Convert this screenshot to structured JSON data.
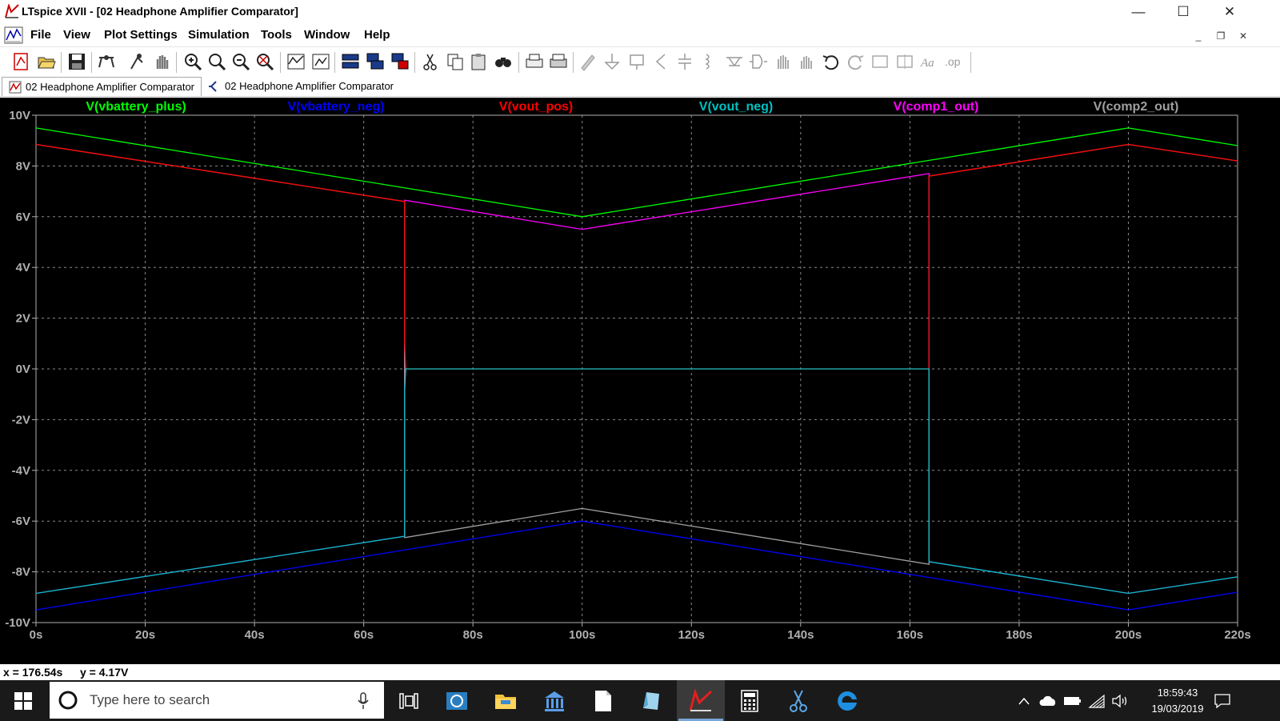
{
  "window": {
    "title": "LTspice XVII - [02 Headphone Amplifier Comparator]",
    "controls": {
      "minimize": "—",
      "maximize": "☐",
      "close": "✕"
    }
  },
  "menu": {
    "items": [
      "File",
      "View",
      "Plot Settings",
      "Simulation",
      "Tools",
      "Window",
      "Help"
    ]
  },
  "tabs": [
    {
      "label": "02 Headphone Amplifier Comparator",
      "icon": "waveform-icon",
      "active": true
    },
    {
      "label": "02 Headphone Amplifier Comparator",
      "icon": "schematic-icon",
      "active": false
    }
  ],
  "chart_data": {
    "type": "line",
    "background": "#000000",
    "grid": true,
    "grid_style": "dashed",
    "xlim": [
      0,
      220
    ],
    "ylim": [
      -10,
      10
    ],
    "x_ticks": [
      0,
      20,
      40,
      60,
      80,
      100,
      120,
      140,
      160,
      180,
      200,
      220
    ],
    "x_tick_labels": [
      "0s",
      "20s",
      "40s",
      "60s",
      "80s",
      "100s",
      "120s",
      "140s",
      "160s",
      "180s",
      "200s",
      "220s"
    ],
    "y_ticks": [
      10,
      8,
      6,
      4,
      2,
      0,
      -2,
      -4,
      -6,
      -8,
      -10
    ],
    "y_tick_labels": [
      "10V",
      "8V",
      "6V",
      "4V",
      "2V",
      "0V",
      "-2V",
      "-4V",
      "-6V",
      "-8V",
      "-10V"
    ],
    "legend_position": "top",
    "series": [
      {
        "name": "V(vbattery_plus)",
        "color": "#00ff00",
        "x": [
          0,
          100,
          200,
          220
        ],
        "y": [
          9.5,
          6.0,
          9.5,
          8.8
        ]
      },
      {
        "name": "V(vbattery_neg)",
        "color": "#0000ff",
        "x": [
          0,
          100,
          200,
          220
        ],
        "y": [
          -9.5,
          -6.0,
          -9.5,
          -8.8
        ]
      },
      {
        "name": "V(vout_pos)",
        "color": "#ff0000",
        "x": [
          0,
          67.5,
          67.5,
          67.7,
          163.5,
          163.5,
          200,
          220
        ],
        "y": [
          8.85,
          6.6,
          1.1,
          0,
          0,
          7.6,
          8.85,
          8.2
        ]
      },
      {
        "name": "V(vout_neg)",
        "color": "#00c0c0",
        "x": [
          0,
          67.5,
          67.5,
          67.7,
          163.5,
          163.5,
          200,
          220
        ],
        "y": [
          -8.85,
          -6.6,
          -0.9,
          0,
          0,
          -7.6,
          -8.85,
          -8.2
        ]
      },
      {
        "name": "V(comp1_out)",
        "color": "#ff00ff",
        "x": [
          0,
          67.5,
          67.5,
          100,
          163.5,
          163.5,
          200,
          220
        ],
        "y": [
          -8.85,
          -6.6,
          6.65,
          5.5,
          7.7,
          -7.6,
          -8.85,
          -8.2
        ]
      },
      {
        "name": "V(comp2_out)",
        "color": "#a0a0a0",
        "x": [
          0,
          67.5,
          67.5,
          100,
          163.5,
          163.5,
          200,
          220
        ],
        "y": [
          8.85,
          6.6,
          -6.65,
          -5.5,
          -7.7,
          7.6,
          8.85,
          8.2
        ]
      }
    ]
  },
  "status": {
    "x_readout": "x = 176.54s",
    "y_readout": "y = 4.17V"
  },
  "taskbar": {
    "search_placeholder": "Type here to search",
    "time": "18:59:43",
    "date": "19/03/2019",
    "apps": [
      "task-view-icon",
      "photos-icon",
      "file-explorer-icon",
      "bank-icon",
      "notepad-icon",
      "paint-icon",
      "ltspice-icon",
      "calculator-icon",
      "snipping-tool-icon",
      "edge-icon"
    ]
  }
}
